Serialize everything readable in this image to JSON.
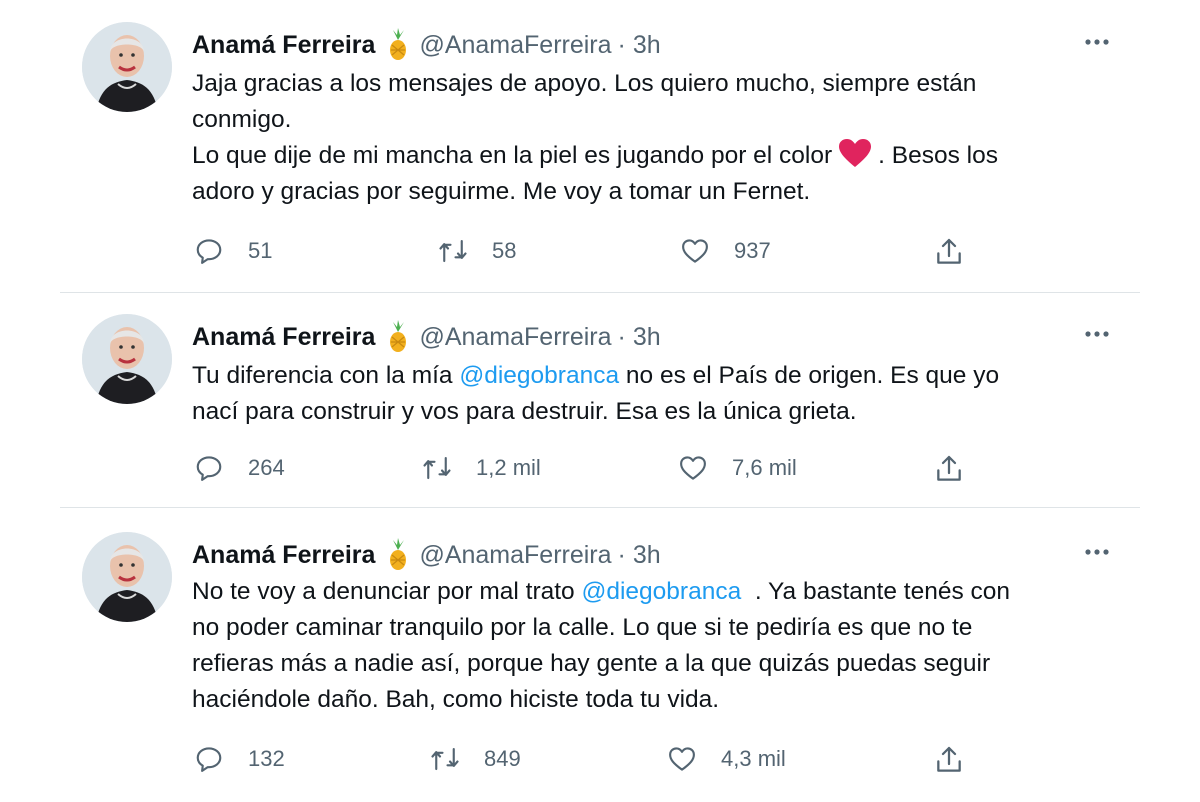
{
  "tweets": [
    {
      "name": "Anamá Ferreira",
      "name_emoji": "pineapple-emoji",
      "handle": "@AnamaFerreira",
      "time": "· 3h",
      "lines": [
        {
          "parts": [
            "Jaja gracias a los mensajes de apoyo. Los quiero mucho, siempre están"
          ]
        },
        {
          "parts": [
            "conmigo."
          ]
        },
        {
          "parts": [
            "Lo que dije de mi mancha en la piel es jugando por el color",
            ". Besos los"
          ]
        },
        {
          "parts": [
            "adoro y gracias por seguirme. Me voy a tomar un Fernet."
          ]
        }
      ],
      "replies": "51",
      "retweets": "58",
      "likes": "937"
    },
    {
      "name": "Anamá Ferreira",
      "name_emoji": "pineapple-emoji",
      "handle": "@AnamaFerreira",
      "time": "· 3h",
      "lines": [
        {
          "parts": [
            "Tu diferencia con la mía ",
            "@diegobranca",
            " no es el País de origen. Es que yo"
          ]
        },
        {
          "parts": [
            "nací para construir y vos para destruir. Esa es la única grieta."
          ]
        }
      ],
      "replies": "264",
      "retweets": "1,2 mil",
      "likes": "7,6 mil"
    },
    {
      "name": "Anamá Ferreira",
      "name_emoji": "pineapple-emoji",
      "handle": "@AnamaFerreira",
      "time": "· 3h",
      "lines": [
        {
          "parts": [
            "No te voy a denunciar por mal trato ",
            "@diegobranca",
            "  . Ya bastante tenés con"
          ]
        },
        {
          "parts": [
            "no poder caminar tranquilo por la calle. Lo que si te pediría es que no te"
          ]
        },
        {
          "parts": [
            "refieras más a nadie así, porque hay gente a la que quizás puedas seguir"
          ]
        },
        {
          "parts": [
            "haciéndole daño. Bah, como hiciste toda tu vida."
          ]
        }
      ],
      "replies": "132",
      "retweets": "849",
      "likes": "4,3 mil"
    }
  ],
  "colors": {
    "text": "#0f1419",
    "secondary": "#536471",
    "mention": "#1d9bf0",
    "divider": "#dfe4e7",
    "heart_emoji": "#e0245e"
  },
  "icons": [
    "more-icon",
    "reply-icon",
    "retweet-icon",
    "like-icon",
    "share-icon"
  ]
}
